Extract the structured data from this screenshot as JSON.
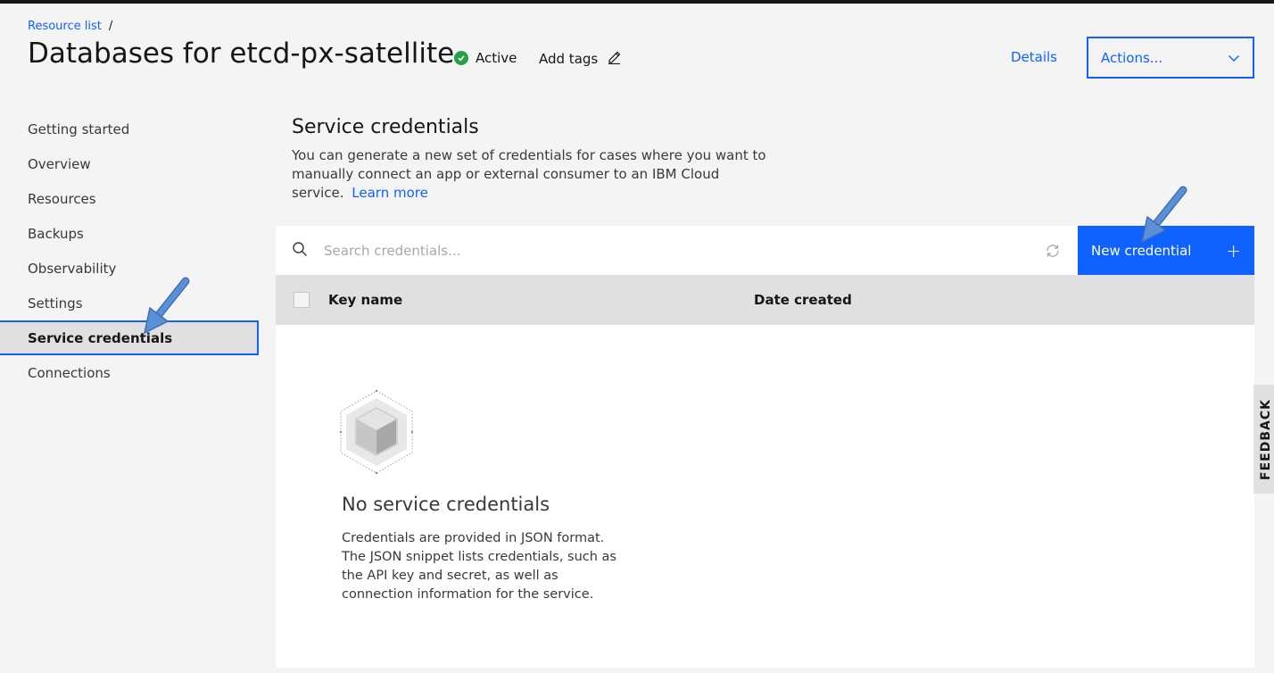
{
  "breadcrumb": {
    "link": "Resource list",
    "separator": "/"
  },
  "header": {
    "title": "Databases for etcd-px-satellite",
    "status": "Active",
    "add_tags": "Add tags",
    "details": "Details",
    "actions": "Actions..."
  },
  "sidebar": {
    "items": [
      {
        "label": "Getting started"
      },
      {
        "label": "Overview"
      },
      {
        "label": "Resources"
      },
      {
        "label": "Backups"
      },
      {
        "label": "Observability"
      },
      {
        "label": "Settings"
      },
      {
        "label": "Service credentials",
        "active": true
      },
      {
        "label": "Connections"
      }
    ]
  },
  "main": {
    "title": "Service credentials",
    "description": "You can generate a new set of credentials for cases where you want to manually connect an app or external consumer to an IBM Cloud service.",
    "learn_more": "Learn more",
    "search_placeholder": "Search credentials...",
    "new_button": "New credential",
    "new_button_icon": "+",
    "table": {
      "columns": [
        "Key name",
        "Date created"
      ]
    },
    "empty": {
      "title": "No service credentials",
      "body": "Credentials are provided in JSON format. The JSON snippet lists credentials, such as the API key and secret, as well as connection information for the service."
    }
  },
  "feedback": "FEEDBACK",
  "colors": {
    "accent": "#0f62fe",
    "status_active": "#24a148",
    "annotation_arrow": "#5b8fd6"
  }
}
